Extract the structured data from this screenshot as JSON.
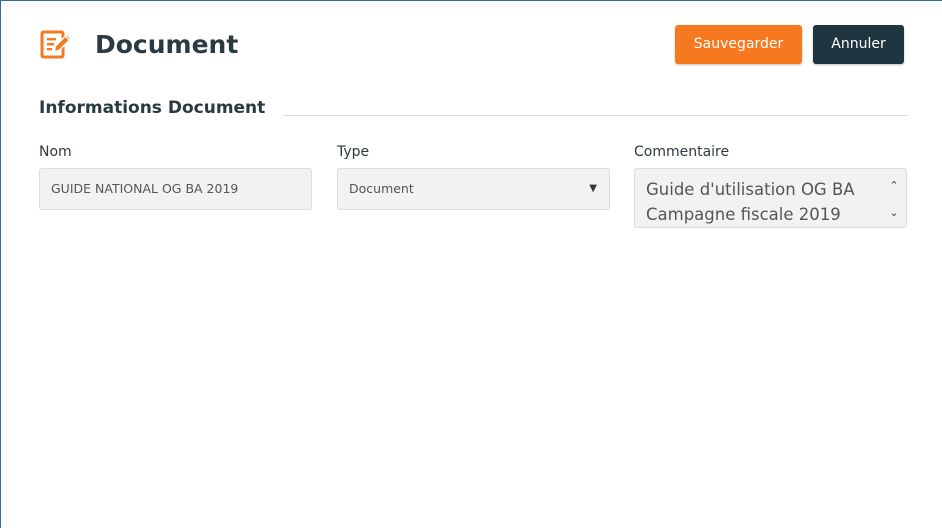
{
  "header": {
    "title": "Document",
    "icon": "edit-document-icon",
    "save_label": "Sauvegarder",
    "cancel_label": "Annuler"
  },
  "section": {
    "title": "Informations Document"
  },
  "fields": {
    "nom": {
      "label": "Nom",
      "value": "GUIDE NATIONAL OG BA 2019"
    },
    "type": {
      "label": "Type",
      "value": "Document"
    },
    "commentaire": {
      "label": "Commentaire",
      "value": "Guide d'utilisation OG BA Campagne fiscale 2019"
    }
  },
  "colors": {
    "accent": "#f7791f",
    "dark": "#1f3641",
    "text": "#2b3a42"
  }
}
